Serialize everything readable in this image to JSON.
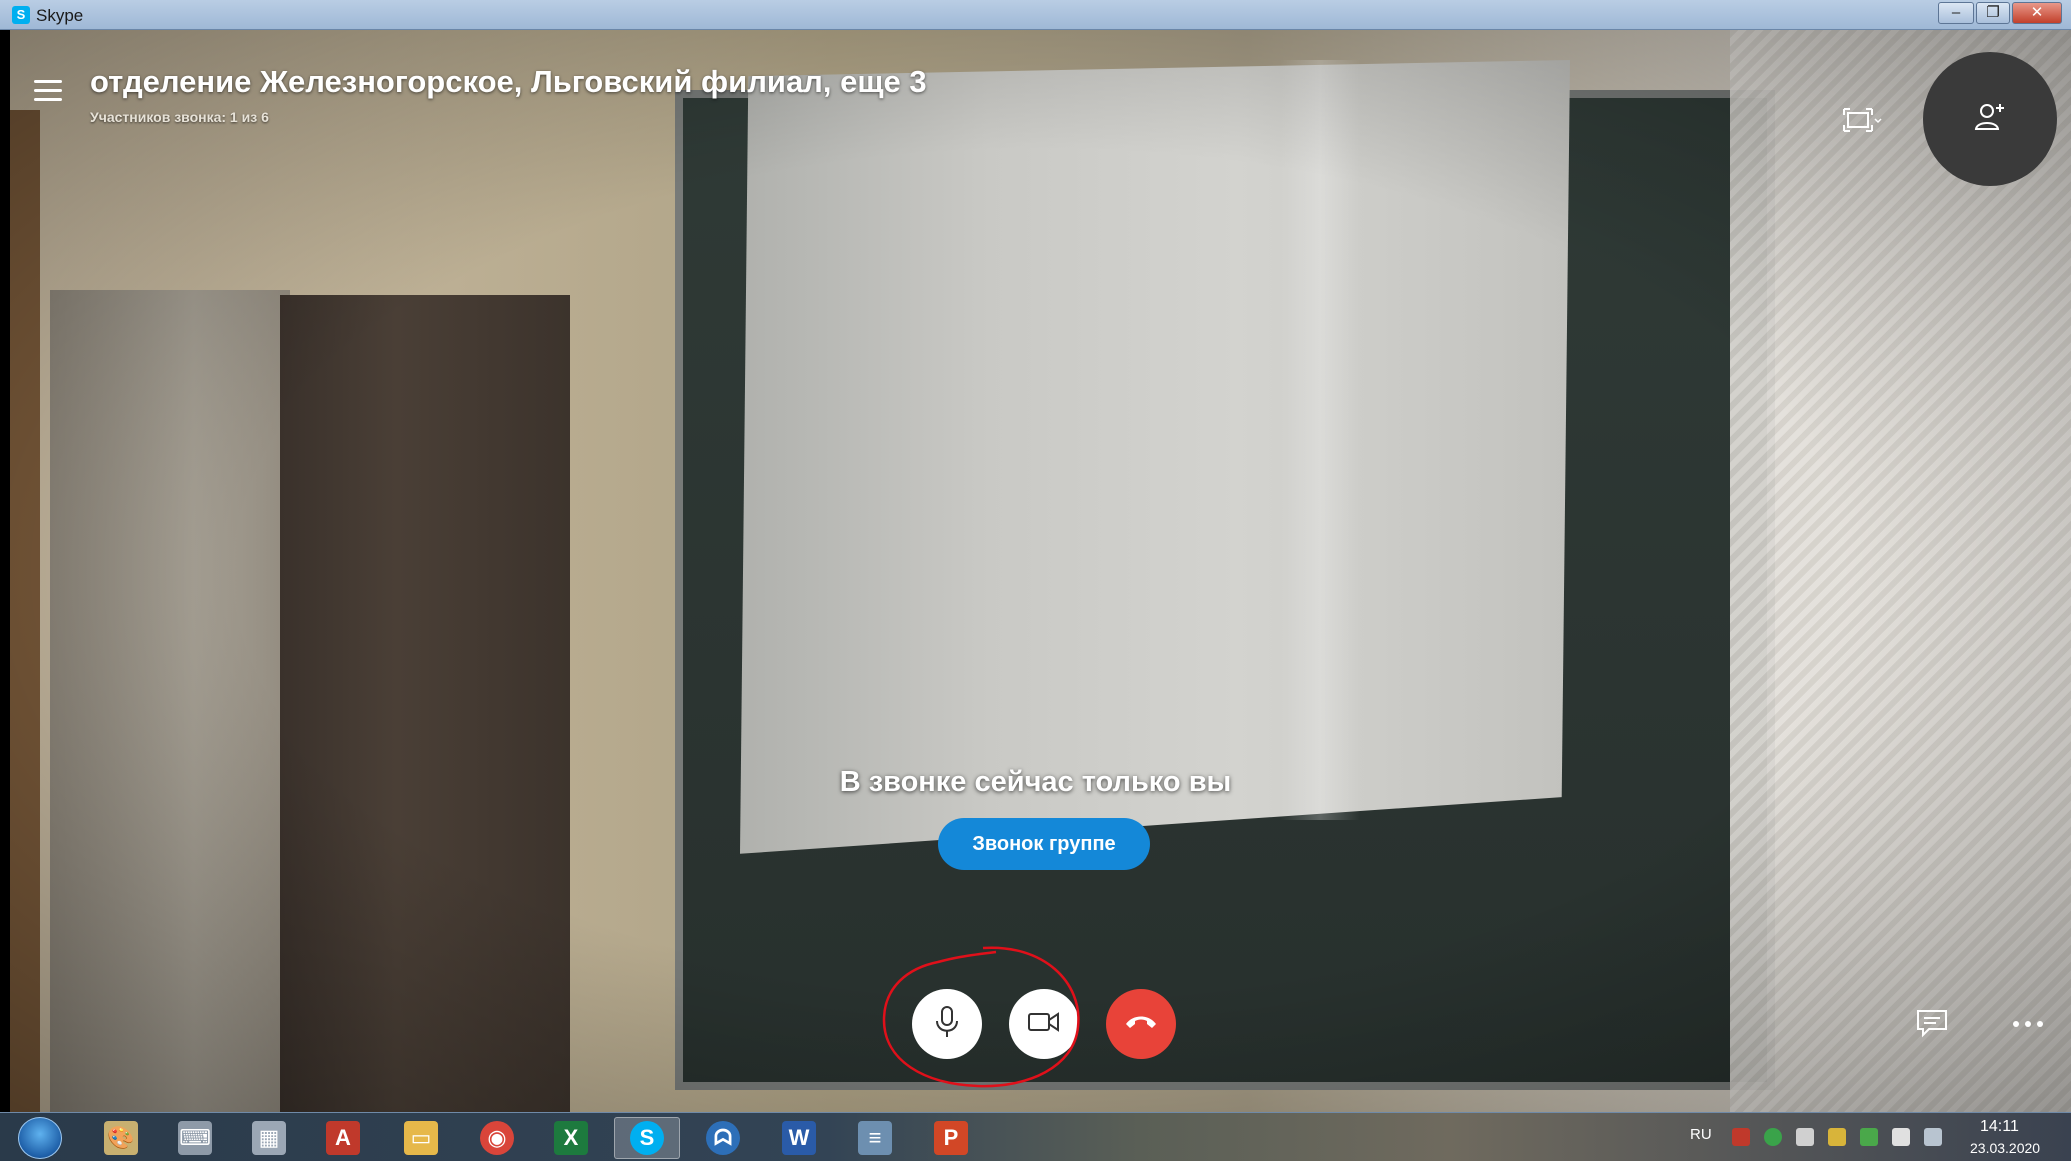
{
  "window": {
    "title": "Skype",
    "app_icon_letter": "S",
    "controls": {
      "minimize": "–",
      "maximize": "❐",
      "close": "✕"
    }
  },
  "call": {
    "title": "отделение Железногорское, Льговский филиал, еще 3",
    "participants": "Участников звонка: 1 из 6",
    "alone_message": "В звонке сейчас только вы",
    "group_call_button": "Звонок группе"
  },
  "controls": {
    "microphone": "microphone-icon",
    "video": "video-camera-icon",
    "hangup": "end-call-icon",
    "chat": "chat-icon",
    "more": "more-options-icon",
    "fullscreen": "fullscreen-icon",
    "add_participant": "add-person-icon",
    "hangup_color": "#e84339",
    "accent_color": "#1488d8",
    "annotation_color": "#e0101a"
  },
  "taskbar": {
    "apps": [
      {
        "name": "paint",
        "glyph": "🎨"
      },
      {
        "name": "keyboard",
        "glyph": "⌨"
      },
      {
        "name": "calculator",
        "glyph": "▦"
      },
      {
        "name": "acrobat",
        "glyph": "A"
      },
      {
        "name": "explorer",
        "glyph": "▭"
      },
      {
        "name": "chrome",
        "glyph": "◉"
      },
      {
        "name": "excel",
        "glyph": "X"
      },
      {
        "name": "skype",
        "glyph": "S"
      },
      {
        "name": "ghost",
        "glyph": "ᗣ"
      },
      {
        "name": "word",
        "glyph": "W"
      },
      {
        "name": "scanner",
        "glyph": "≡"
      },
      {
        "name": "powerpoint",
        "glyph": "P"
      }
    ],
    "language": "RU",
    "time": "14:11",
    "date": "23.03.2020"
  }
}
